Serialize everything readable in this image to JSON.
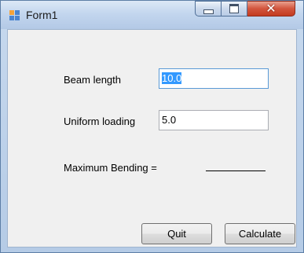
{
  "window": {
    "title": "Form1",
    "icons": {
      "app": "form-app-icon",
      "minimize": "minimize-icon",
      "maximize": "maximize-icon",
      "close": "close-icon"
    },
    "close_glyph": "✕"
  },
  "form": {
    "beam_length": {
      "label": "Beam length",
      "value": "10.0"
    },
    "uniform_loading": {
      "label": "Uniform loading",
      "value": "5.0"
    },
    "maximum_bending": {
      "label": "Maximum Bending ="
    }
  },
  "buttons": {
    "quit": "Quit",
    "calculate": "Calculate"
  },
  "colors": {
    "selection": "#3399ff",
    "close_button": "#c33a20",
    "client_bg": "#f0f0f0"
  }
}
